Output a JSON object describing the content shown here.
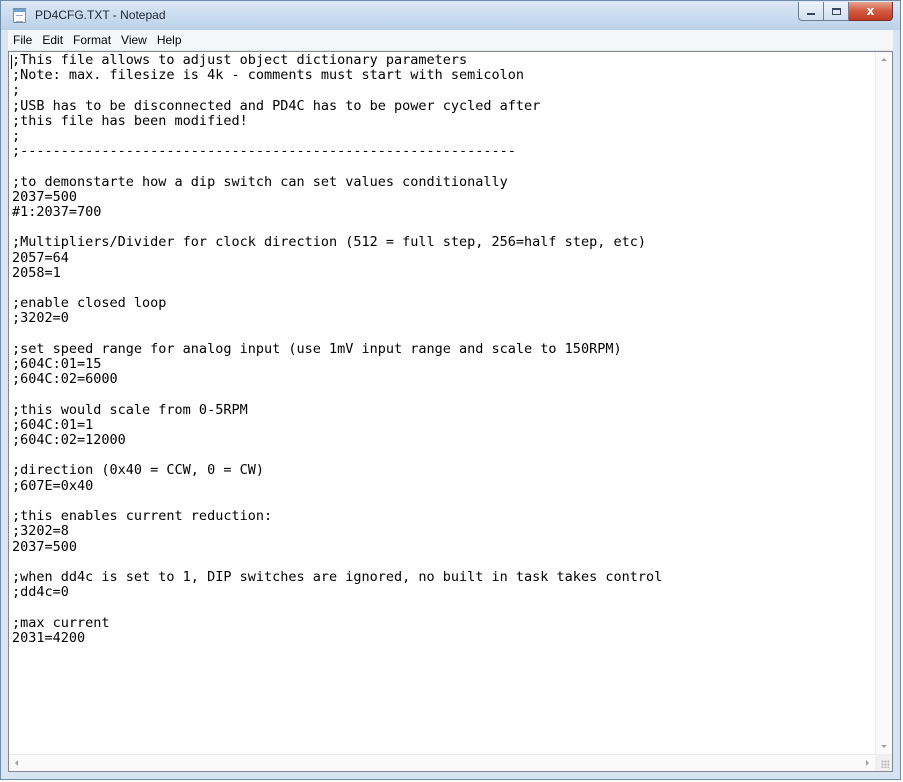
{
  "window": {
    "title": "PD4CFG.TXT - Notepad",
    "icon": "notepad-icon",
    "buttons": {
      "minimize": "minimize-icon",
      "maximize": "maximize-icon",
      "close": "x"
    }
  },
  "menu": {
    "file": "File",
    "edit": "Edit",
    "format": "Format",
    "view": "View",
    "help": "Help"
  },
  "document": {
    "text": ";This file allows to adjust object dictionary parameters\n;Note: max. filesize is 4k - comments must start with semicolon\n;\n;USB has to be disconnected and PD4C has to be power cycled after\n;this file has been modified!\n;\n;-------------------------------------------------------------\n\n;to demonstarte how a dip switch can set values conditionally\n2037=500\n#1:2037=700\n\n;Multipliers/Divider for clock direction (512 = full step, 256=half step, etc)\n2057=64\n2058=1\n\n;enable closed loop\n;3202=0\n\n;set speed range for analog input (use 1mV input range and scale to 150RPM)\n;604C:01=15\n;604C:02=6000\n\n;this would scale from 0-5RPM\n;604C:01=1\n;604C:02=12000\n\n;direction (0x40 = CCW, 0 = CW)\n;607E=0x40\n\n;this enables current reduction:\n;3202=8\n2037=500\n\n;when dd4c is set to 1, DIP switches are ignored, no built in task takes control\n;dd4c=0\n\n;max current\n2031=4200"
  }
}
